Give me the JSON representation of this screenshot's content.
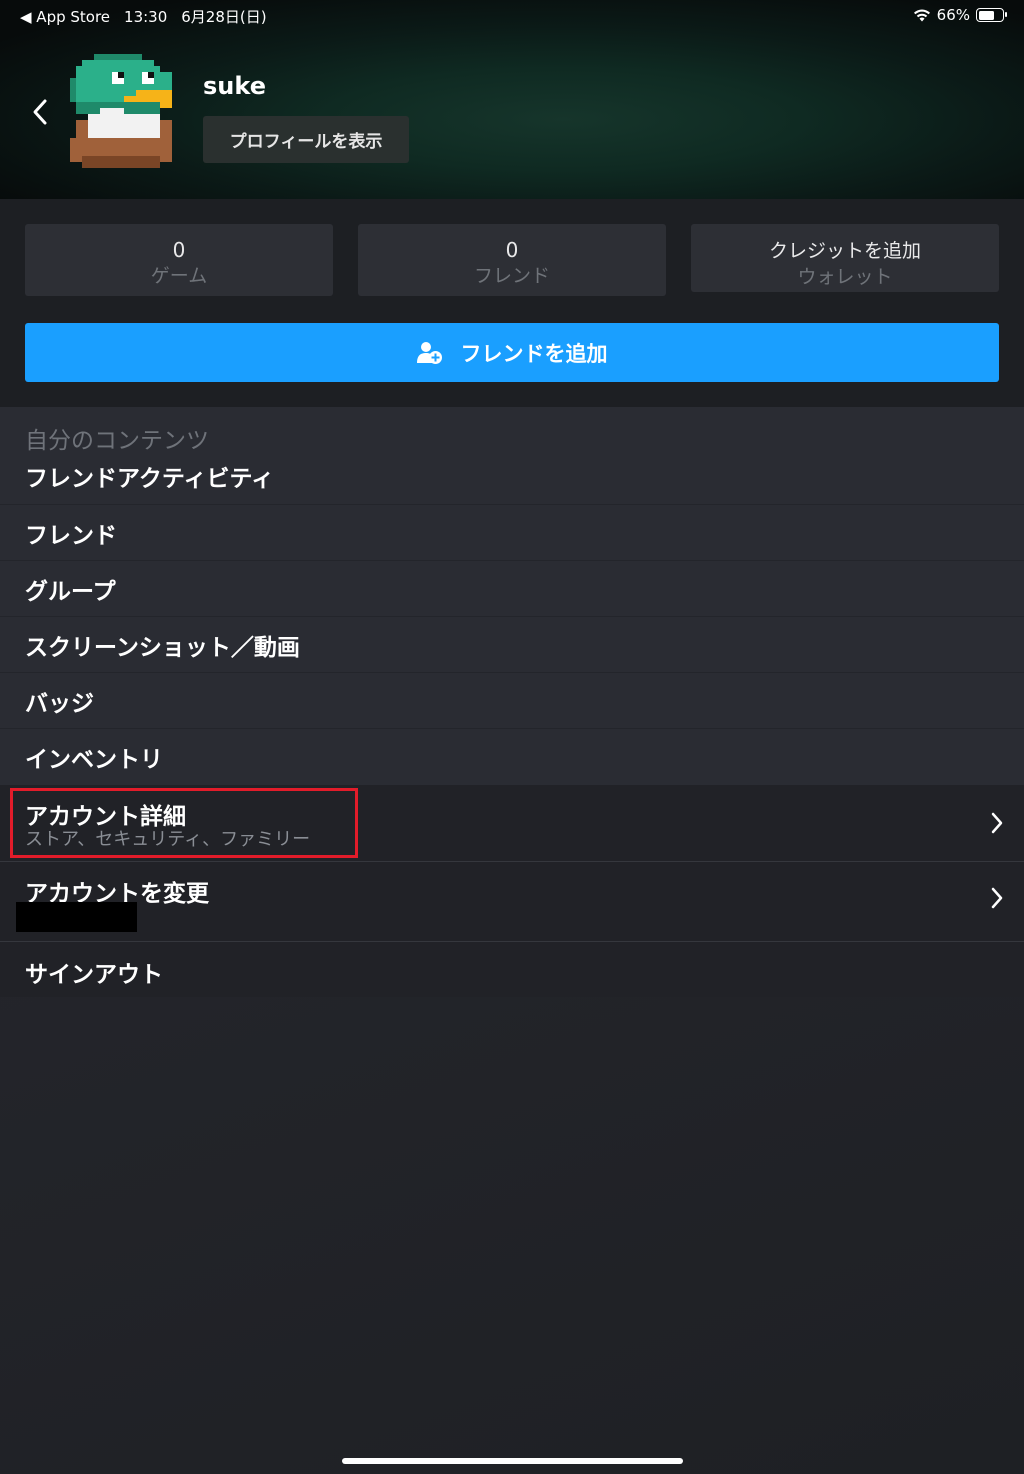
{
  "status_bar": {
    "back_app": "◀ App Store",
    "time": "13:30",
    "date": "6月28日(日)",
    "battery": "66%",
    "battery_level": 0.66
  },
  "profile": {
    "username": "suke",
    "view_profile_label": "プロフィールを表示"
  },
  "stats": [
    {
      "value": "0",
      "label": "ゲーム"
    },
    {
      "value": "0",
      "label": "フレンド"
    },
    {
      "value": "クレジットを追加",
      "label": "ウォレット"
    }
  ],
  "add_friend_label": "フレンドを追加",
  "my_content": {
    "header": "自分のコンテンツ",
    "items": [
      "フレンドアクティビティ",
      "フレンド",
      "グループ",
      "スクリーンショット／動画",
      "バッジ",
      "インベントリ"
    ]
  },
  "account": {
    "details_title": "アカウント詳細",
    "details_subtitle": "ストア、セキュリティ、ファミリー",
    "change_title": "アカウントを変更",
    "sign_out": "サインアウト"
  },
  "colors": {
    "accent": "#1a9fff",
    "highlight": "#e21c2a"
  }
}
